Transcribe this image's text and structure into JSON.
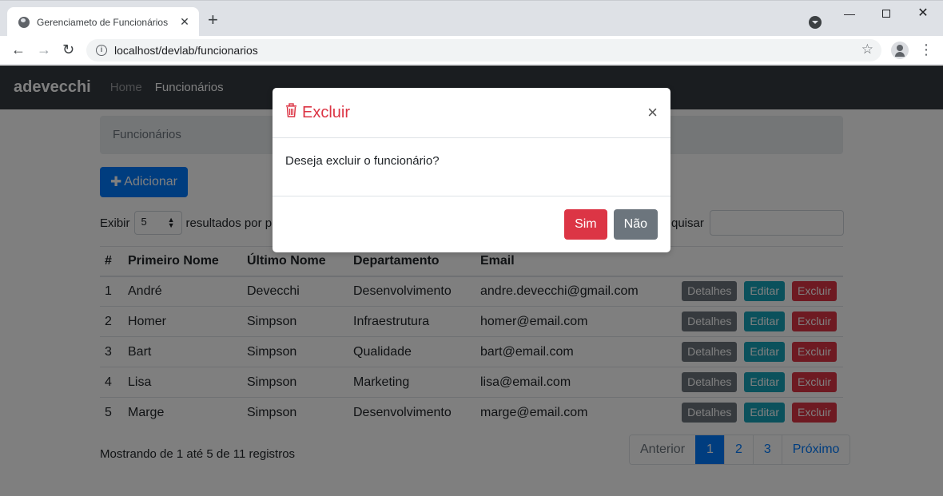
{
  "browser": {
    "tab_title": "Gerenciameto de Funcionários",
    "url": "localhost/devlab/funcionarios"
  },
  "navbar": {
    "brand": "adevecchi",
    "links": [
      "Home",
      "Funcionários"
    ]
  },
  "breadcrumb": "Funcionários",
  "add_button": "Adicionar",
  "length": {
    "prefix": "Exibir",
    "value": "5",
    "suffix": "resultados por p"
  },
  "search_label": "quisar",
  "table": {
    "headers": [
      "#",
      "Primeiro Nome",
      "Último Nome",
      "Departamento",
      "Email"
    ],
    "rows": [
      {
        "id": "1",
        "first": "André",
        "last": "Devecchi",
        "dept": "Desenvolvimento",
        "email": "andre.devecchi@gmail.com"
      },
      {
        "id": "2",
        "first": "Homer",
        "last": "Simpson",
        "dept": "Infraestrutura",
        "email": "homer@email.com"
      },
      {
        "id": "3",
        "first": "Bart",
        "last": "Simpson",
        "dept": "Qualidade",
        "email": "bart@email.com"
      },
      {
        "id": "4",
        "first": "Lisa",
        "last": "Simpson",
        "dept": "Marketing",
        "email": "lisa@email.com"
      },
      {
        "id": "5",
        "first": "Marge",
        "last": "Simpson",
        "dept": "Desenvolvimento",
        "email": "marge@email.com"
      }
    ],
    "actions": {
      "details": "Detalhes",
      "edit": "Editar",
      "delete": "Excluir"
    }
  },
  "info": "Mostrando de 1 até 5 de 11 registros",
  "pagination": {
    "prev": "Anterior",
    "pages": [
      "1",
      "2",
      "3"
    ],
    "active": "1",
    "next": "Próximo"
  },
  "modal": {
    "title": "Excluir",
    "close": "×",
    "message": "Deseja excluir o funcionário?",
    "yes": "Sim",
    "no": "Não"
  },
  "colors": {
    "danger": "#dc3545",
    "primary": "#007bff",
    "secondary": "#6c757d",
    "info": "#17a2b8",
    "navbar": "#343a40"
  },
  "icons": [
    "globe-icon",
    "trash-icon",
    "plus-icon",
    "star-icon",
    "info-icon"
  ]
}
